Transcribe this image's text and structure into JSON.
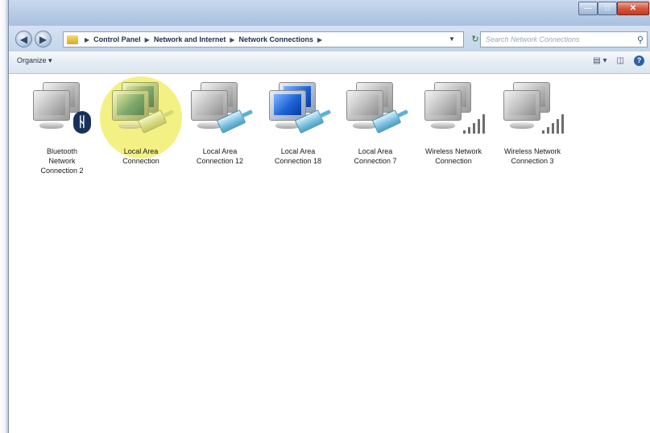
{
  "window": {
    "caption_buttons": [
      "minimize",
      "maximize",
      "close"
    ]
  },
  "navbar": {
    "breadcrumbs": [
      "Control Panel",
      "Network and Internet",
      "Network Connections"
    ],
    "search_placeholder": "Search Network Connections"
  },
  "cmdbar": {
    "organize_label": "Organize ▾"
  },
  "connections": [
    {
      "line1": "Bluetooth",
      "line2": "Network",
      "line3": "Connection 2",
      "type": "bluetooth",
      "highlighted": false
    },
    {
      "line1": "Local Area",
      "line2": "Connection",
      "line3": "",
      "type": "lan",
      "highlighted": true
    },
    {
      "line1": "Local Area",
      "line2": "Connection 12",
      "line3": "",
      "type": "lan",
      "highlighted": false
    },
    {
      "line1": "Local Area",
      "line2": "Connection 18",
      "line3": "",
      "type": "lan-blue",
      "highlighted": false
    },
    {
      "line1": "Local Area",
      "line2": "Connection 7",
      "line3": "",
      "type": "lan",
      "highlighted": false
    },
    {
      "line1": "Wireless Network",
      "line2": "Connection",
      "line3": "",
      "type": "wireless",
      "highlighted": false
    },
    {
      "line1": "Wireless Network",
      "line2": "Connection 3",
      "line3": "",
      "type": "wireless",
      "highlighted": false
    }
  ],
  "colors": {
    "highlight": "#f3ef77",
    "titlebar": "#b9cde6",
    "selected_screen": "#1e63d6"
  }
}
